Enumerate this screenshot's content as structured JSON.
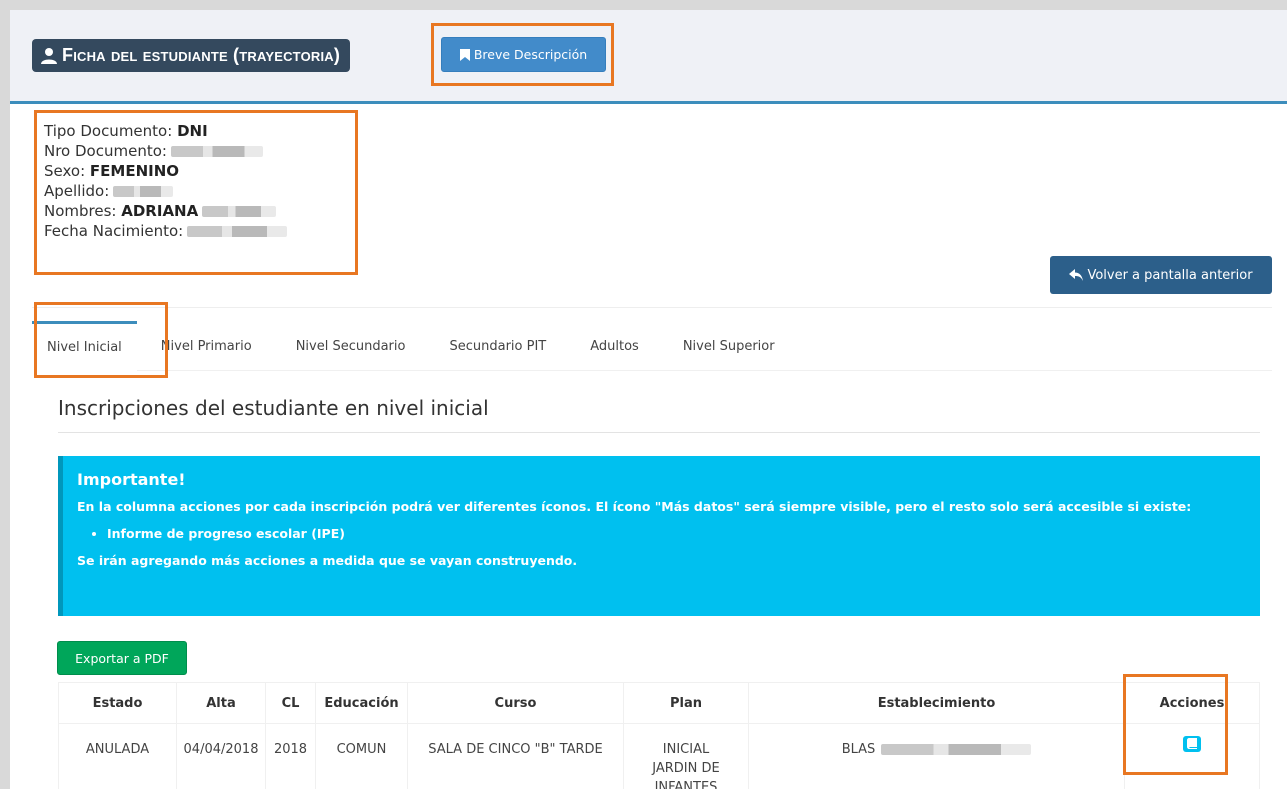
{
  "header": {
    "title": "Ficha del estudiante (trayectoria)",
    "breve_label": "Breve Descripción"
  },
  "student": {
    "tipo_documento_label": "Tipo Documento:",
    "tipo_documento_value": "DNI",
    "nro_documento_label": "Nro Documento:",
    "sexo_label": "Sexo:",
    "sexo_value": "FEMENINO",
    "apellido_label": "Apellido:",
    "nombres_label": "Nombres:",
    "nombres_value": "ADRIANA",
    "fecha_nacimiento_label": "Fecha Nacimiento:"
  },
  "volver_label": "Volver a pantalla anterior",
  "tabs": [
    {
      "label": "Nivel Inicial"
    },
    {
      "label": "Nivel Primario"
    },
    {
      "label": "Nivel Secundario"
    },
    {
      "label": "Secundario PIT"
    },
    {
      "label": "Adultos"
    },
    {
      "label": "Nivel Superior"
    }
  ],
  "section_title": "Inscripciones del estudiante en nivel inicial",
  "alert": {
    "title": "Importante!",
    "text": "En la columna acciones por cada inscripción podrá ver diferentes íconos. El ícono \"Más datos\" será siempre visible, pero el resto solo será accesible si existe:",
    "bullet": "Informe de progreso escolar (IPE)",
    "footer": "Se irán agregando más acciones a medida que se vayan construyendo."
  },
  "export_label": "Exportar a PDF",
  "table": {
    "headers": [
      "Estado",
      "Alta",
      "CL",
      "Educación",
      "Curso",
      "Plan",
      "Establecimiento",
      "Acciones"
    ],
    "rows": [
      {
        "estado": "ANULADA",
        "alta": "04/04/2018",
        "cl": "2018",
        "educacion": "COMUN",
        "curso": "SALA DE CINCO \"B\" TARDE",
        "plan": "INICIAL JARDIN DE INFANTES",
        "establecimiento": "BLAS"
      }
    ]
  },
  "colors": {
    "accent": "#3c8dbc",
    "highlight": "#e87722",
    "alert": "#00c0ef",
    "success": "#00a65a"
  }
}
